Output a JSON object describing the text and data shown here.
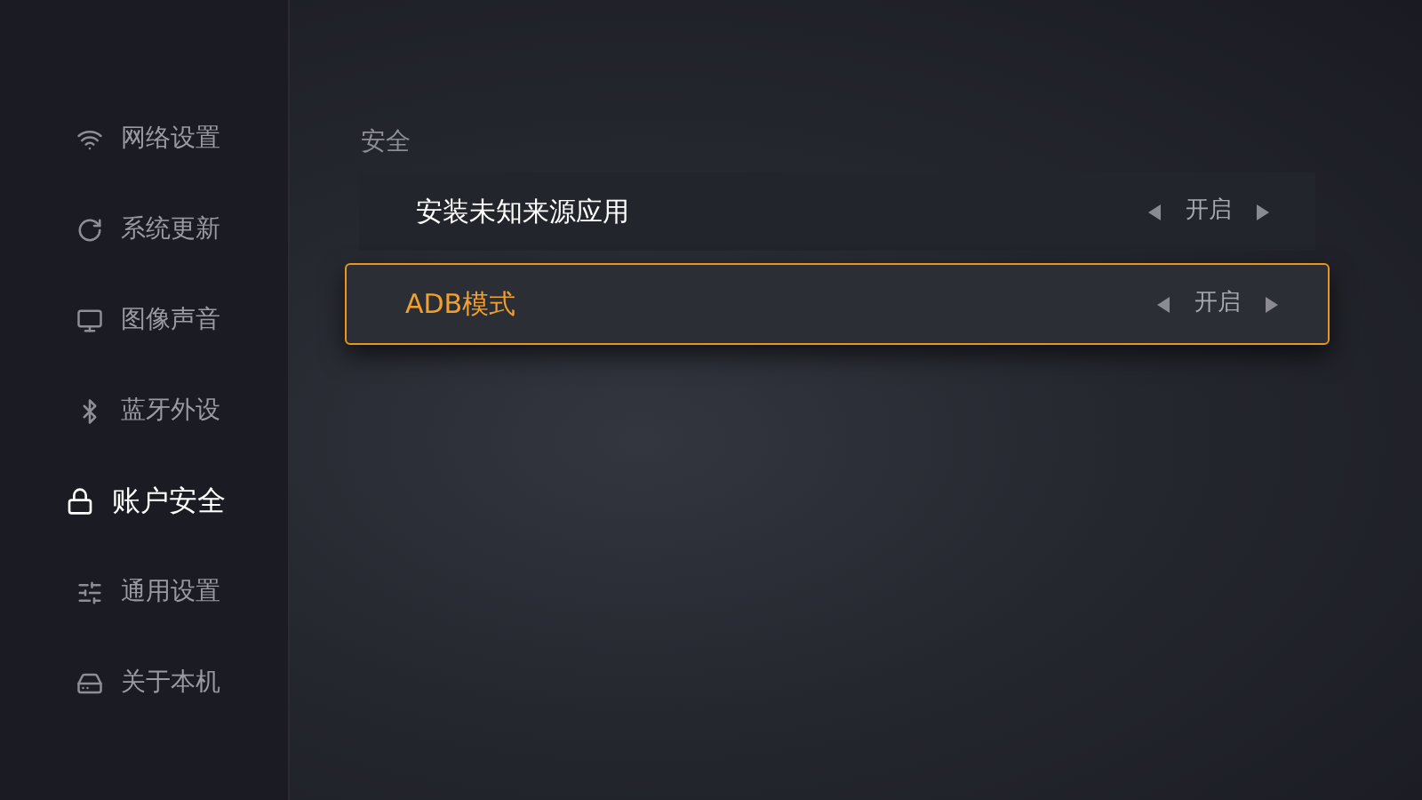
{
  "sidebar": {
    "items": [
      {
        "label": "网络设置",
        "selected": false
      },
      {
        "label": "系统更新",
        "selected": false
      },
      {
        "label": "图像声音",
        "selected": false
      },
      {
        "label": "蓝牙外设",
        "selected": false
      },
      {
        "label": "账户安全",
        "selected": true
      },
      {
        "label": "通用设置",
        "selected": false
      },
      {
        "label": "关于本机",
        "selected": false
      }
    ]
  },
  "section": {
    "title": "安全",
    "rows": [
      {
        "label": "安装未知来源应用",
        "value": "开启",
        "selected": false
      },
      {
        "label": "ADB模式",
        "value": "开启",
        "selected": true
      }
    ]
  }
}
